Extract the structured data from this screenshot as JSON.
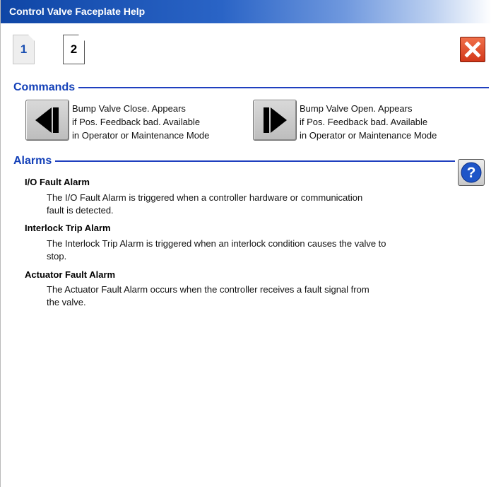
{
  "window": {
    "title": "Control Valve Faceplate Help"
  },
  "page_tabs": [
    {
      "label": "1",
      "selected": true
    },
    {
      "label": "2",
      "selected": false
    }
  ],
  "close_icon": "close-x-icon",
  "sections": {
    "commands": {
      "title": "Commands"
    },
    "alarms": {
      "title": "Alarms"
    }
  },
  "commands": [
    {
      "icon": "bump-close-icon",
      "text": "Bump Valve Close.  Appears\nif Pos. Feedback bad.  Available\nin Operator or Maintenance Mode"
    },
    {
      "icon": "bump-open-icon",
      "text": "Bump Valve Open.  Appears\nif Pos. Feedback bad.  Available\nin Operator or Maintenance Mode"
    }
  ],
  "help_icon": "question-mark-icon",
  "alarms": [
    {
      "name": "I/O Fault Alarm",
      "desc_line1": "The I/O Fault Alarm is triggered when a controller hardware or communication",
      "desc_line2": "fault is detected."
    },
    {
      "name": "Interlock Trip Alarm",
      "desc_line1": "The Interlock Trip Alarm is triggered when an interlock condition causes the valve to",
      "desc_line2": "stop."
    },
    {
      "name": "Actuator Fault Alarm",
      "desc_line1": "The Actuator Fault Alarm occurs when the controller receives a fault signal from",
      "desc_line2": "the valve."
    }
  ],
  "colors": {
    "title_bar": "#0f46a6",
    "section_title": "#1340b8",
    "close_button": "#d3381a",
    "help_circle": "#1e55c8"
  }
}
